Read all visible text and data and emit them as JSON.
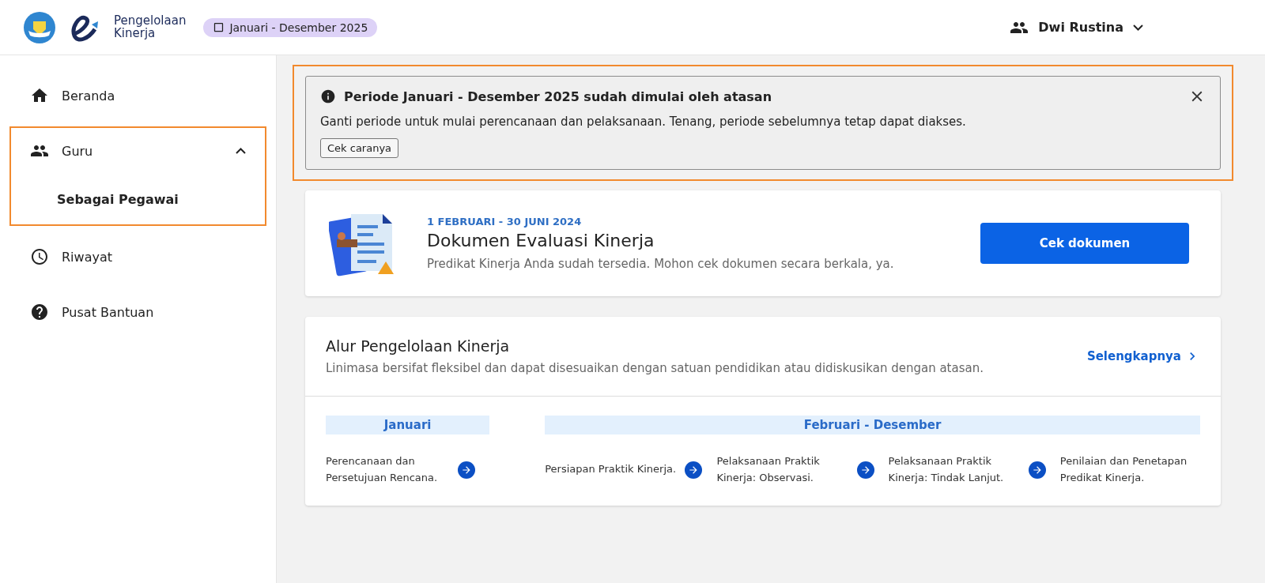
{
  "header": {
    "app_name_line1": "Pengelolaan",
    "app_name_line2": "Kinerja",
    "period_badge": "Januari - Desember 2025",
    "user": "Dwi Rustina"
  },
  "sidebar": {
    "items": [
      {
        "kind": "link",
        "label": "Beranda",
        "highlighted": false
      },
      {
        "kind": "group",
        "label": "Guru",
        "expanded": true,
        "highlighted": true,
        "children": [
          {
            "label": "Sebagai Pegawai",
            "selected": true
          }
        ]
      },
      {
        "kind": "link",
        "label": "Riwayat",
        "highlighted": false
      },
      {
        "kind": "link",
        "label": "Pusat Bantuan",
        "highlighted": false
      }
    ]
  },
  "banner": {
    "title": "Periode Januari - Desember 2025 sudah dimulai oleh atasan",
    "text": "Ganti periode untuk mulai perencanaan dan pelaksanaan. Tenang, periode sebelumnya tetap dapat diakses.",
    "button": "Cek caranya",
    "highlighted": true
  },
  "document_card": {
    "date": "1 FEBRUARI - 30 JUNI 2024",
    "title": "Dokumen Evaluasi Kinerja",
    "text": "Predikat Kinerja Anda sudah tersedia. Mohon cek dokumen secara berkala, ya.",
    "button": "Cek dokumen"
  },
  "flow_card": {
    "title": "Alur Pengelolaan Kinerja",
    "subtitle": "Linimasa bersifat fleksibel dan dapat disesuaikan dengan satuan pendidikan atau didiskusikan dengan atasan.",
    "link": "Selengkapnya",
    "phases": [
      {
        "label": "Januari",
        "steps": [
          "Perencanaan dan Persetujuan Rencana."
        ]
      },
      {
        "label": "Februari - Desember",
        "steps": [
          "Persiapan Praktik Kinerja.",
          "Pelaksanaan Praktik Kinerja: Observasi.",
          "Pelaksanaan Praktik Kinerja: Tindak Lanjut.",
          "Penilaian dan Penetapan Predikat Kinerja."
        ]
      }
    ]
  }
}
